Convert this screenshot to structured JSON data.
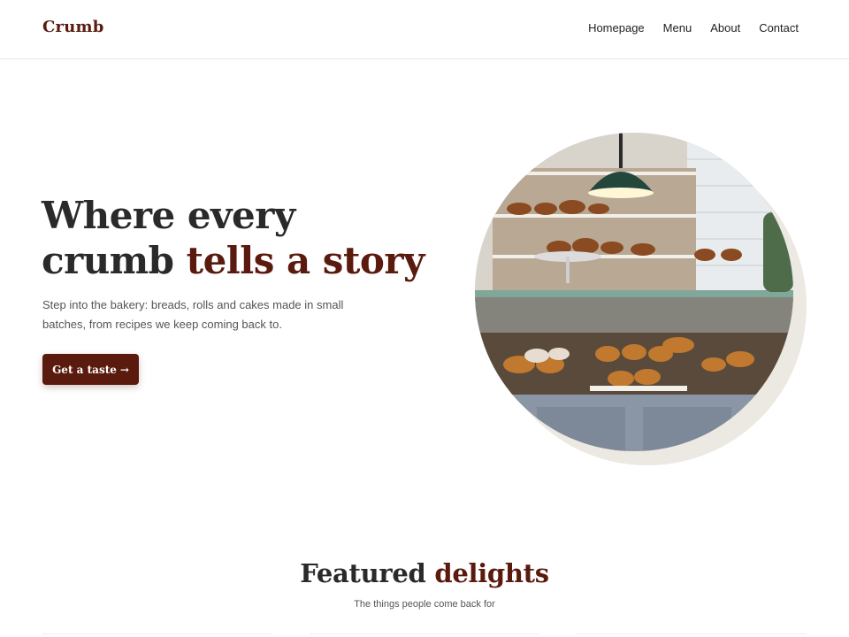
{
  "header": {
    "brand": "Crumb",
    "nav": [
      {
        "label": "Homepage"
      },
      {
        "label": "Menu"
      },
      {
        "label": "About"
      },
      {
        "label": "Contact"
      }
    ]
  },
  "hero": {
    "title_line1": "Where every",
    "title_line2_plain": "crumb ",
    "title_line2_accent": "tells a story",
    "subtitle": "Step into the bakery: breads, rolls and cakes made in small batches, from recipes we keep coming back to.",
    "cta_label": "Get a taste",
    "cta_arrow": "→",
    "image_subject": "bakery display case with pastries"
  },
  "featured": {
    "title_plain": "Featured ",
    "title_accent": "delights",
    "subtitle": "The things people come back for"
  },
  "colors": {
    "accent": "#5a1a0e",
    "text": "#2a2a2a",
    "muted": "#555555"
  }
}
